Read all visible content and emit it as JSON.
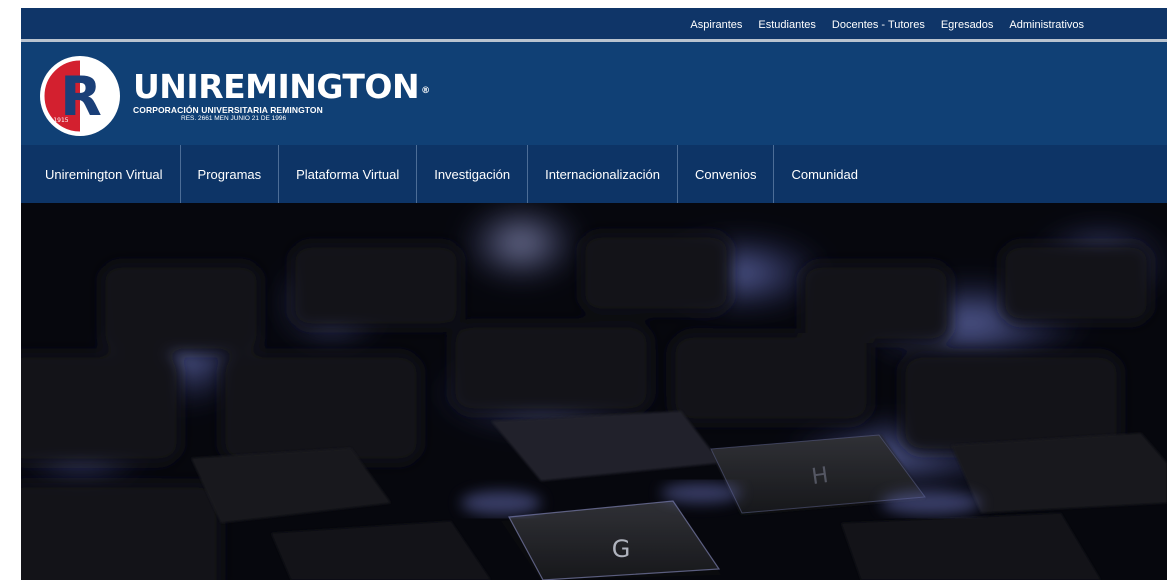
{
  "utility_nav": {
    "links": [
      "Aspirantes",
      "Estudiantes",
      "Docentes - Tutores",
      "Egresados",
      "Administrativos"
    ]
  },
  "logo": {
    "brand": "UNIREMINGTON",
    "registered_mark": "®",
    "subtitle": "CORPORACIÓN UNIVERSITARIA REMINGTON",
    "resolution": "RES. 2661 MEN JUNIO 21 DE 1996",
    "emblem_letter": "R",
    "emblem_year": "1915",
    "colors": {
      "red": "#d3202f",
      "white": "#ffffff",
      "navy": "#104075"
    }
  },
  "main_nav": {
    "items": [
      "Uniremington Virtual",
      "Programas",
      "Plataforma Virtual",
      "Investigación",
      "Internacionalización",
      "Convenios",
      "Comunidad"
    ]
  },
  "hero": {
    "image": "keyboard-photo",
    "key_g": "G",
    "key_h": "H"
  },
  "colors": {
    "header_bg": "#104075",
    "nav_bg": "#0d3466",
    "utility_bg": "#0f3568",
    "divider": "#b9c3cf"
  }
}
